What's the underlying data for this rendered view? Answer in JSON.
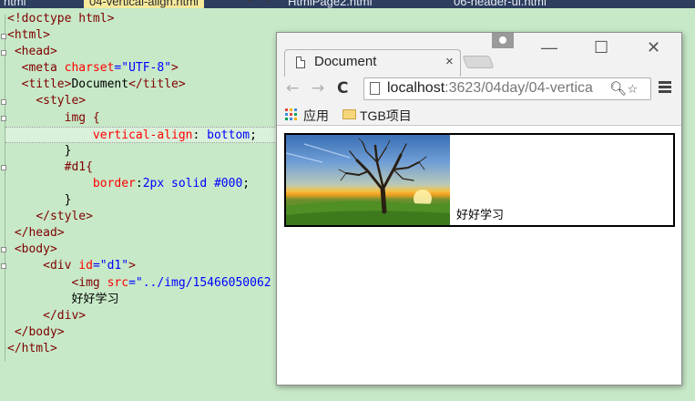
{
  "editor_tabs": [
    {
      "label": "html",
      "active": false
    },
    {
      "label": "04-vertical-align.html",
      "active": true
    },
    {
      "label": "HtmlPage2.html",
      "active": false
    },
    {
      "label": "06-header-ui.html",
      "active": false
    }
  ],
  "code": {
    "l1": [
      "<!doctype ",
      "html",
      ">"
    ],
    "l2": "<html>",
    "l3": "<head>",
    "l4": [
      "<meta ",
      "charset",
      "=",
      "\"UTF-8\"",
      ">"
    ],
    "l5": [
      "<title>",
      "Document",
      "</title>"
    ],
    "l6": "<style>",
    "l7": "img {",
    "l8": [
      "vertical-align",
      ": ",
      "bottom",
      ";"
    ],
    "l9": "}",
    "l10": "#d1{",
    "l11": [
      "border",
      ":",
      "2px solid #000",
      ";"
    ],
    "l12": "}",
    "l13": "</style>",
    "l14": "</head>",
    "l15": "<body>",
    "l16": [
      "<div ",
      "id",
      "=",
      "\"d1\"",
      ">"
    ],
    "l17": [
      "<img ",
      "src",
      "=",
      "\"../img/15466050062"
    ],
    "l18": "好好学习",
    "l19": "</div>",
    "l20": "</body>",
    "l21": "</html>"
  },
  "browser": {
    "tab_title": "Document",
    "tab_close": "×",
    "window_controls": {
      "minimize": "—",
      "maximize": "☐",
      "close": "✕"
    },
    "nav": {
      "back": "←",
      "forward": "→",
      "reload": "C"
    },
    "url_host": "localhost",
    "url_rest": ":3623/04day/04-vertica",
    "bookmarks": {
      "apps": "应用",
      "folder": "TGB项目"
    },
    "page_text": "好好学习"
  },
  "colors": {
    "editor_bg": "#c7e9c8",
    "tag": "#800000",
    "attr": "#ff0000",
    "value": "#0000ff",
    "tab_active": "#f5e99b",
    "tab_strip": "#2d3e5f"
  },
  "icons": [
    "document-icon",
    "user-icon",
    "zoom-icon",
    "star-icon",
    "menu-icon",
    "apps-icon",
    "folder-icon",
    "pin-icon"
  ]
}
